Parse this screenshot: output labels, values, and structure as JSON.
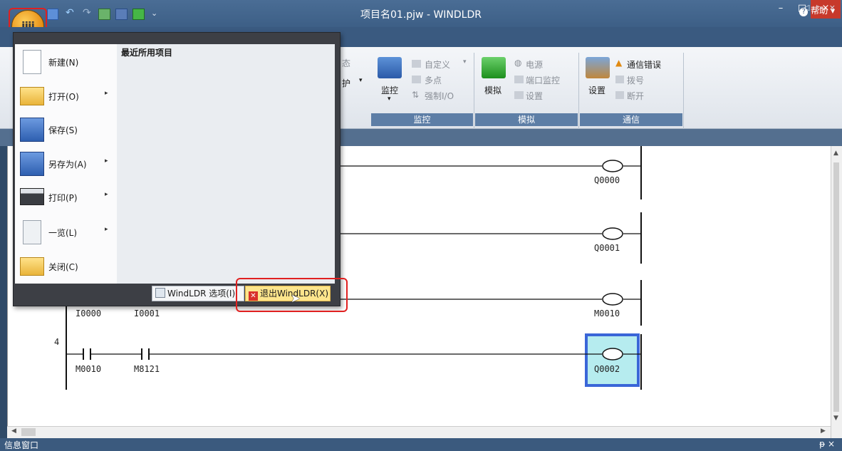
{
  "window": {
    "title": "项目名01.pjw - WINDLDR",
    "min": "–",
    "max": "□",
    "close": "×"
  },
  "ribbon": {
    "help": "帮助",
    "partial_state": "态",
    "partial_protect": "护",
    "monitor_group": {
      "label": "监控",
      "big": "监控",
      "custom": "自定义",
      "multi": "多点",
      "force_io": "强制I/O"
    },
    "simulate_group": {
      "label": "模拟",
      "big": "模拟",
      "power": "电源",
      "port_monitor": "端口监控",
      "settings": "设置"
    },
    "comm_group": {
      "label": "通信",
      "big": "设置",
      "comm_error": "通信错误",
      "dial": "拨号",
      "disconnect": "断开"
    }
  },
  "app_menu": {
    "recent_title": "最近所用项目",
    "items": [
      {
        "label": "新建(N)",
        "arrow": false
      },
      {
        "label": "打开(O)",
        "arrow": true
      },
      {
        "label": "保存(S)",
        "arrow": false
      },
      {
        "label": "另存为(A)",
        "arrow": true
      },
      {
        "label": "打印(P)",
        "arrow": true
      },
      {
        "label": "一览(L)",
        "arrow": true
      },
      {
        "label": "关闭(C)",
        "arrow": false
      }
    ],
    "options_button": "WindLDR 选项(I)",
    "exit_button": "退出WindLDR(X)"
  },
  "ladder": {
    "coils": [
      "Q0000",
      "Q0001",
      "M0010",
      "Q0002"
    ],
    "rung3_contacts": [
      "I0000",
      "I0001"
    ],
    "rung4_number": "4",
    "rung4_contacts": [
      "M0010",
      "M8121"
    ]
  },
  "info_window": {
    "title": "信息窗口",
    "pin": "ᵽ ×"
  },
  "doc_tab_controls": "◁ ▷ ×",
  "colors": {
    "title_bar": "#3d5f86",
    "selection_fill": "#b6ecef",
    "selection_border": "#3a66d8",
    "highlight_red": "#e02020"
  }
}
